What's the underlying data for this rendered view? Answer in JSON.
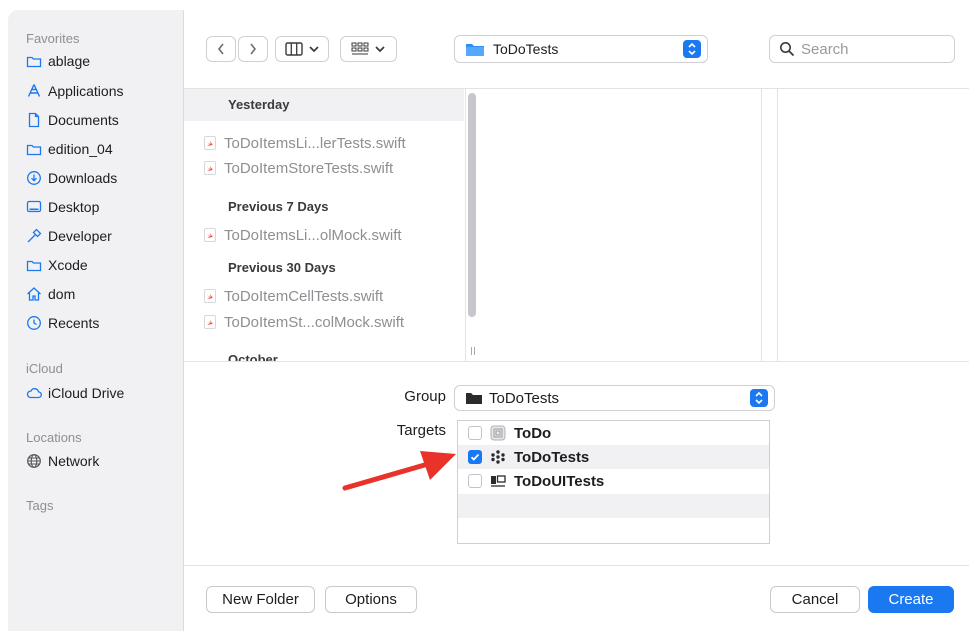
{
  "sidebar": {
    "sections": {
      "favorites": "Favorites",
      "icloud": "iCloud",
      "locations": "Locations",
      "tags": "Tags"
    },
    "favorites": [
      {
        "label": "ablage",
        "icon": "folder-icon"
      },
      {
        "label": "Applications",
        "icon": "applications-icon"
      },
      {
        "label": "Documents",
        "icon": "document-icon"
      },
      {
        "label": "edition_04",
        "icon": "folder-icon"
      },
      {
        "label": "Downloads",
        "icon": "download-icon"
      },
      {
        "label": "Desktop",
        "icon": "desktop-icon"
      },
      {
        "label": "Developer",
        "icon": "hammer-icon"
      },
      {
        "label": "Xcode",
        "icon": "folder-icon"
      },
      {
        "label": "dom",
        "icon": "home-icon"
      },
      {
        "label": "Recents",
        "icon": "clock-icon"
      }
    ],
    "icloud": [
      {
        "label": "iCloud Drive",
        "icon": "cloud-icon"
      }
    ],
    "locations": [
      {
        "label": "Network",
        "icon": "network-icon"
      }
    ]
  },
  "toolbar": {
    "location": "ToDoTests",
    "search_placeholder": "Search"
  },
  "browser": {
    "groups": [
      {
        "header": "Yesterday",
        "files": [
          "ToDoItemsLi...lerTests.swift",
          "ToDoItemStoreTests.swift"
        ]
      },
      {
        "header": "Previous 7 Days",
        "files": [
          "ToDoItemsLi...olMock.swift"
        ]
      },
      {
        "header": "Previous 30 Days",
        "files": [
          "ToDoItemCellTests.swift",
          "ToDoItemSt...colMock.swift"
        ]
      },
      {
        "header": "October",
        "files": []
      }
    ]
  },
  "options": {
    "group_label": "Group",
    "group_value": "ToDoTests",
    "targets_label": "Targets",
    "targets": [
      {
        "name": "ToDo",
        "checked": false,
        "icon": "app-target-icon"
      },
      {
        "name": "ToDoTests",
        "checked": true,
        "icon": "unit-test-target-icon"
      },
      {
        "name": "ToDoUITests",
        "checked": false,
        "icon": "ui-test-target-icon"
      }
    ]
  },
  "buttons": {
    "new_folder": "New Folder",
    "options": "Options",
    "cancel": "Cancel",
    "create": "Create"
  },
  "colors": {
    "accent": "#1a78f0",
    "annotation_arrow": "#e8322a"
  }
}
